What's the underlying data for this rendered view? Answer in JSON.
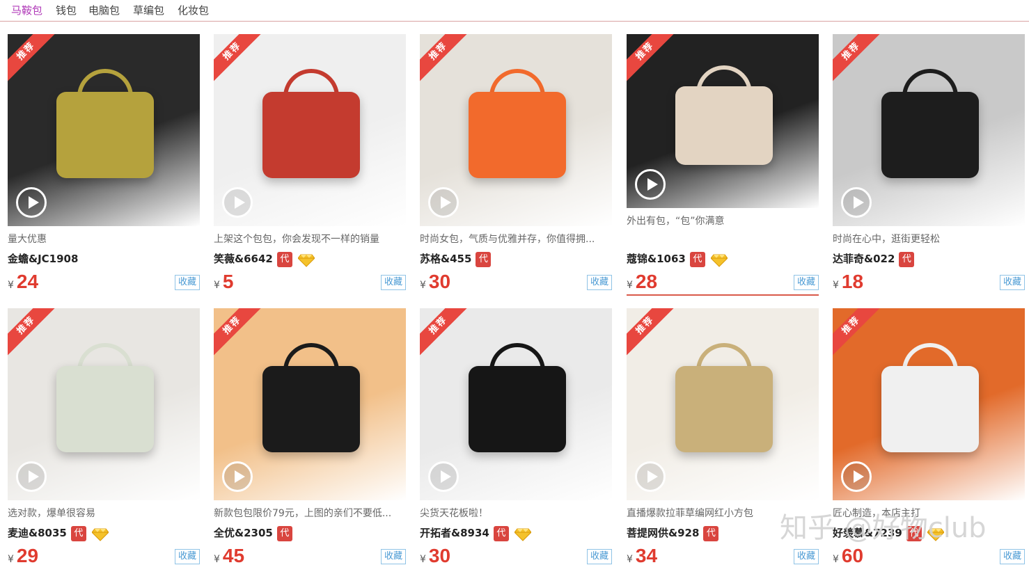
{
  "nav": {
    "items": [
      {
        "label": "马鞍包",
        "active": true
      },
      {
        "label": "钱包",
        "active": false
      },
      {
        "label": "电脑包",
        "active": false
      },
      {
        "label": "草编包",
        "active": false
      },
      {
        "label": "化妆包",
        "active": false
      }
    ]
  },
  "badge_label": "推荐",
  "fav_label": "收藏",
  "dai_label": "代",
  "yen": "¥",
  "products": [
    {
      "desc": "量大优惠",
      "shop": "金蟾&JC1908",
      "dai": false,
      "diamond": false,
      "price": "24",
      "thumb_color": "#b5a23d",
      "bg": "#2a2a2a"
    },
    {
      "desc": "上架这个包包，你会发现不一样的销量",
      "shop": "笑薇&6642",
      "dai": true,
      "diamond": true,
      "price": "5",
      "thumb_color": "#c43b2f",
      "bg": "#efefef"
    },
    {
      "desc": "时尚女包，气质与优雅并存，你值得拥...",
      "shop": "苏格&455",
      "dai": true,
      "diamond": false,
      "price": "30",
      "thumb_color": "#f26a2c",
      "bg": "#e5e1da"
    },
    {
      "desc": "外出有包，“包”你满意",
      "shop": "蔻锦&1063",
      "dai": true,
      "diamond": true,
      "price": "28",
      "thumb_color": "#e3d4c2",
      "bg": "#222222"
    },
    {
      "desc": "时尚在心中，逛街更轻松",
      "shop": "达菲奇&022",
      "dai": true,
      "diamond": false,
      "price": "18",
      "thumb_color": "#1d1d1d",
      "bg": "#c9c9c9"
    },
    {
      "desc": "选对款，爆单很容易",
      "shop": "麦迪&8035",
      "dai": true,
      "diamond": true,
      "price": "29",
      "thumb_color": "#d9dfd1",
      "bg": "#e8e6e2"
    },
    {
      "desc": "新款包包限价79元，上图的亲们不要低...",
      "shop": "全优&2305",
      "dai": true,
      "diamond": false,
      "price": "45",
      "thumb_color": "#1b1b1b",
      "bg": "#f2c089"
    },
    {
      "desc": "尖货天花板啦！",
      "shop": "开拓者&8934",
      "dai": true,
      "diamond": true,
      "price": "30",
      "thumb_color": "#161616",
      "bg": "#eaeaea"
    },
    {
      "desc": "直播爆款拉菲草编网红小方包",
      "shop": "菩提网供&928",
      "dai": true,
      "diamond": false,
      "price": "34",
      "thumb_color": "#c9b07a",
      "bg": "#f1ede6"
    },
    {
      "desc": "匠心制造，本店主打",
      "shop": "好羡慕&7239",
      "dai": true,
      "diamond": true,
      "price": "60",
      "thumb_color": "#f0f0f0",
      "bg": "#e26a2a"
    }
  ],
  "watermark": "知乎 @好物club",
  "colors": {
    "accent": "#e03b2f",
    "nav_active": "#b03ab8",
    "fav_border": "#8fc3e6",
    "ribbon": "#e8473f"
  },
  "icons": {
    "play": "play-circle-icon",
    "diamond": "diamond-vip-icon"
  }
}
